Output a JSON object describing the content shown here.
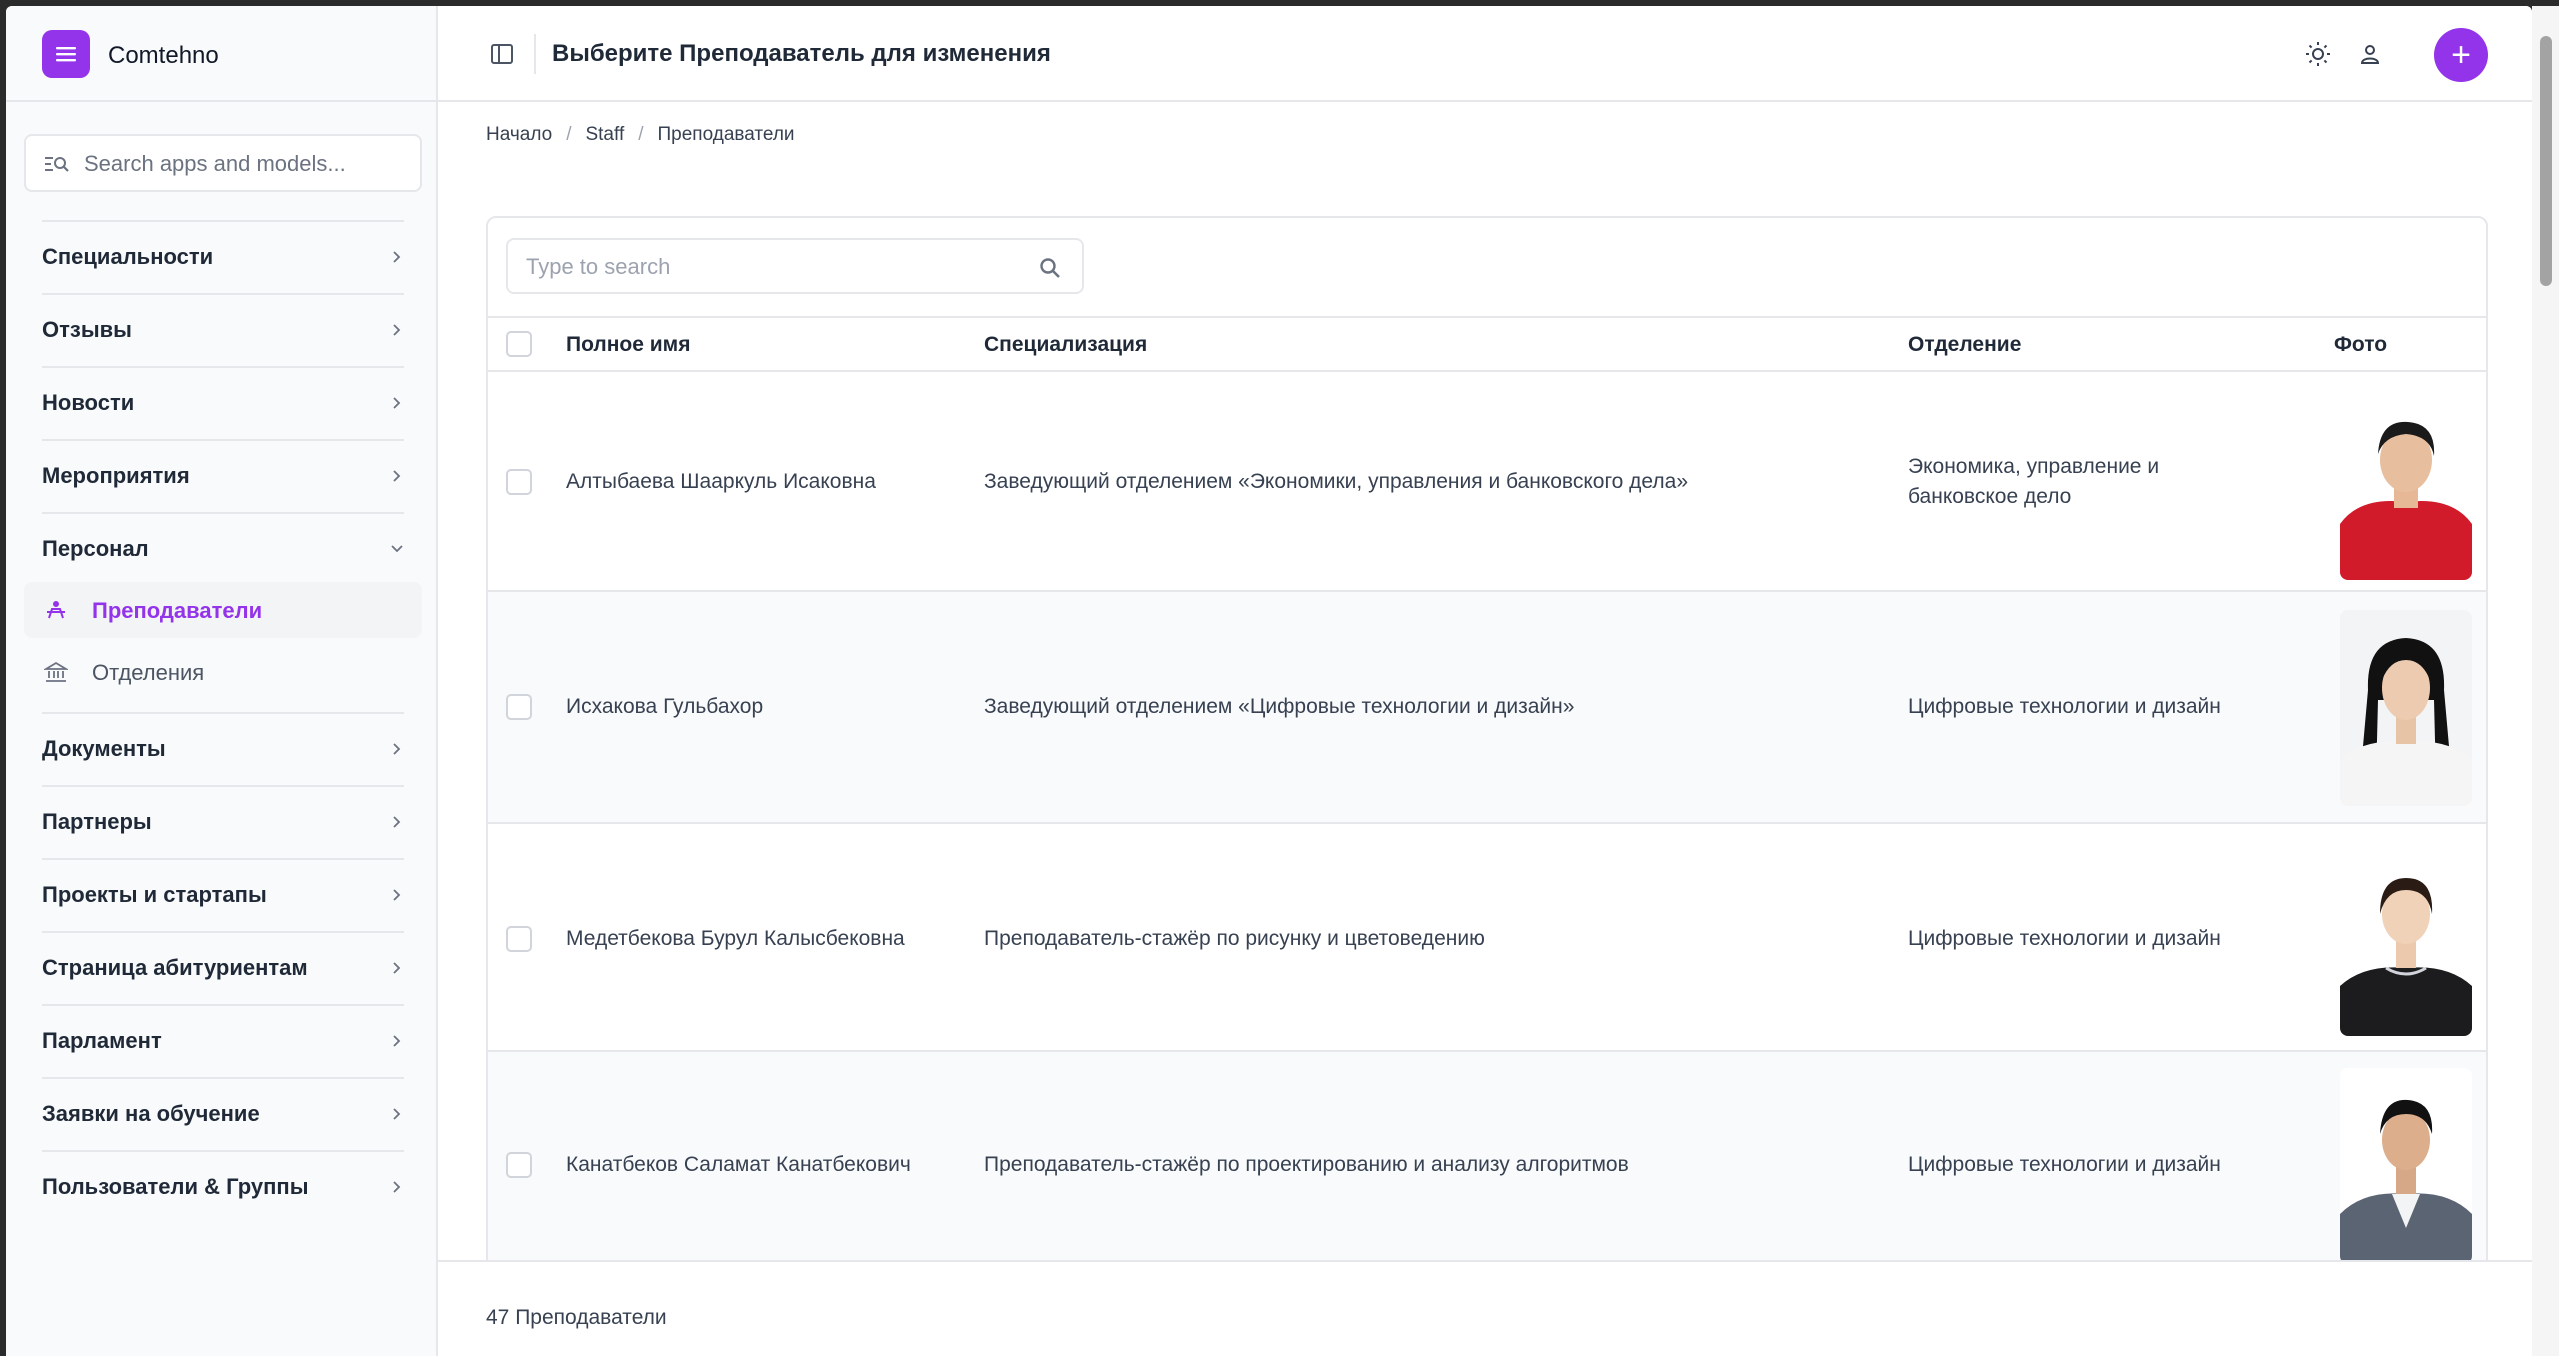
{
  "brand": {
    "name": "Comtehno",
    "accent": "#9333ea"
  },
  "sidebar": {
    "search_placeholder": "Search apps and models...",
    "items": [
      {
        "label": "Специальности"
      },
      {
        "label": "Отзывы"
      },
      {
        "label": "Новости"
      },
      {
        "label": "Мероприятия"
      },
      {
        "label": "Персонал"
      },
      {
        "label": "Документы"
      },
      {
        "label": "Партнеры"
      },
      {
        "label": "Проекты и стартапы"
      },
      {
        "label": "Страница абитуриентам"
      },
      {
        "label": "Парламент"
      },
      {
        "label": "Заявки на обучение"
      },
      {
        "label": "Пользователи & Группы"
      }
    ],
    "sub_items": [
      {
        "label": "Преподаватели",
        "icon": "teacher-icon"
      },
      {
        "label": "Отделения",
        "icon": "building-icon"
      }
    ]
  },
  "header": {
    "title": "Выберите Преподаватель для изменения",
    "add_label": "+"
  },
  "breadcrumb": [
    "Начало",
    "Staff",
    "Преподаватели"
  ],
  "table": {
    "search_placeholder": "Type to search",
    "columns": [
      "Полное имя",
      "Специализация",
      "Отделение",
      "Фото"
    ],
    "rows": [
      {
        "name": "Алтыбаева Шааркуль Исаковна",
        "spec": "Заведующий отделением «Экономики, управления и банковского дела»",
        "dept": "Экономика, управление и банковское дело"
      },
      {
        "name": "Исхакова Гульбахор",
        "spec": "Заведующий отделением «Цифровые технологии и дизайн»",
        "dept": "Цифровые технологии и дизайн"
      },
      {
        "name": "Медетбекова Бурул Калысбековна",
        "spec": "Преподаватель-стажёр по рисунку и цветоведению",
        "dept": "Цифровые технологии и дизайн"
      },
      {
        "name": "Канатбеков Саламат Канатбекович",
        "spec": "Преподаватель-стажёр по проектированию и анализу алгоритмов",
        "dept": "Цифровые технологии и дизайн"
      }
    ]
  },
  "footer": {
    "count_text": "47 Преподаватели"
  }
}
